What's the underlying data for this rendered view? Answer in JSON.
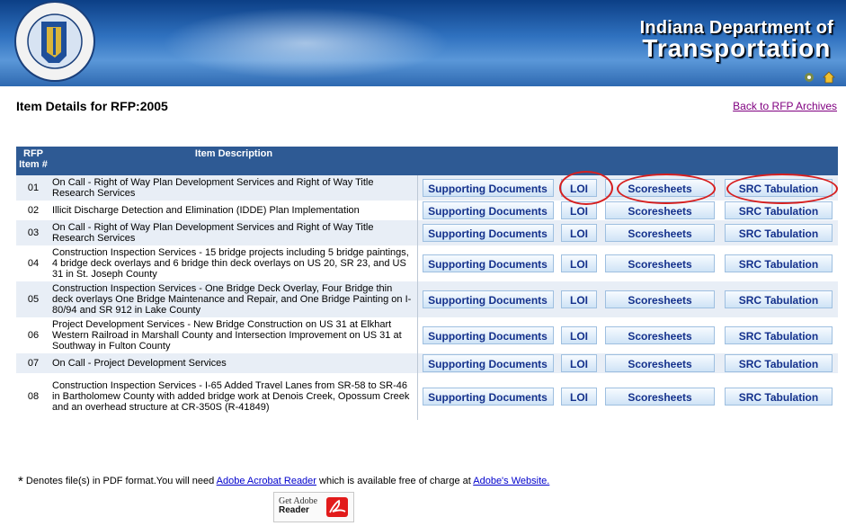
{
  "header": {
    "agency_line1": "Indiana Department of",
    "agency_line2": "Transportation",
    "logo_icon": "indot-seal-logo",
    "icons": [
      "settings-icon",
      "home-icon"
    ]
  },
  "page": {
    "title": "Item Details for RFP:2005",
    "back_link": "Back to RFP Archives"
  },
  "table": {
    "col_item": "RFP Item #",
    "col_desc": "Item Description",
    "rows": [
      {
        "num": "01",
        "desc": "On Call - Right of Way Plan Development Services and Right of Way Title Research Services"
      },
      {
        "num": "02",
        "desc": "Illicit Discharge Detection and Elimination (IDDE) Plan Implementation"
      },
      {
        "num": "03",
        "desc": "On Call - Right of Way Plan Development Services and Right of Way Title Research Services"
      },
      {
        "num": "04",
        "desc": "Construction Inspection Services - 15 bridge projects including 5 bridge paintings, 4 bridge deck overlays and 6 bridge thin deck overlays on US 20, SR 23, and US 31 in St. Joseph County"
      },
      {
        "num": "05",
        "desc": "Construction Inspection Services - One Bridge Deck Overlay, Four Bridge thin deck overlays One Bridge Maintenance and Repair, and One Bridge Painting on I-80/94 and SR 912 in Lake County"
      },
      {
        "num": "06",
        "desc": "Project Development Services - New Bridge Construction on US 31 at Elkhart Western Railroad in Marshall County and Intersection Improvement on US 31 at Southway in Fulton County"
      },
      {
        "num": "07",
        "desc": "On Call - Project Development Services"
      },
      {
        "num": "08",
        "desc": "Construction Inspection Services - I-65 Added Travel Lanes from SR-58 to SR-46 in Bartholomew County with added bridge work at Denois Creek, Opossum Creek and an overhead structure at CR-350S (R-41849)"
      }
    ],
    "buttons": {
      "supporting": "Supporting Documents",
      "loi": "LOI",
      "scoresheets": "Scoresheets",
      "src": "SRC Tabulation"
    }
  },
  "footer": {
    "asterisk": "*",
    "note_text": "Denotes file(s) in PDF format.You will need",
    "reader_link": "Adobe Acrobat Reader",
    "note_mid": "which is available free of charge at",
    "website_link": "Adobe's Website.",
    "badge_line1": "Get Adobe",
    "badge_line2": "Reader"
  },
  "colors": {
    "header_dark": "#0c3f86",
    "table_header": "#2e5a94",
    "button_text": "#14318c",
    "annotation_circle": "#d61f1f",
    "link": "#0000cc"
  }
}
